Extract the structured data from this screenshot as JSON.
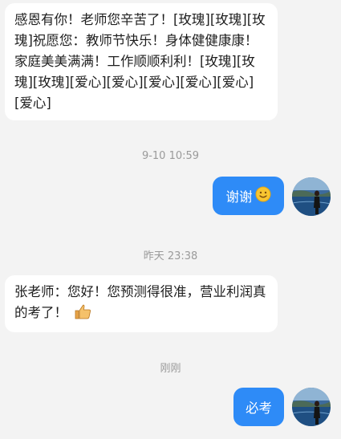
{
  "messages": [
    {
      "type": "incoming",
      "text": "感恩有你！老师您辛苦了！[玫瑰][玫瑰][玫瑰]祝愿您：教师节快乐！身体健健康康！家庭美美满满！工作顺顺利利！[玫瑰][玫瑰][玫瑰][爱心][爱心][爱心][爱心][爱心][爱心]"
    },
    {
      "type": "timestamp",
      "text": "9-10 10:59"
    },
    {
      "type": "outgoing",
      "text": "谢谢",
      "emoji": "smile-emoji"
    },
    {
      "type": "timestamp",
      "text": "昨天 23:38"
    },
    {
      "type": "incoming",
      "text": "张老师：您好！您预测得很准，营业利润真的考了！",
      "emoji": "thumbs-up-emoji"
    },
    {
      "type": "timestamp",
      "text": "刚刚"
    },
    {
      "type": "outgoing",
      "text": "必考"
    }
  ],
  "colors": {
    "background": "#f3f3f3",
    "incoming_bubble": "#ffffff",
    "outgoing_bubble": "#2e8bf7",
    "timestamp_text": "#9a9a9a"
  }
}
